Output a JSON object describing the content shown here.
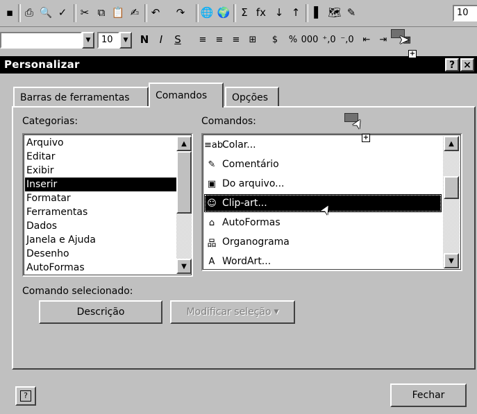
{
  "toolbar": {
    "row1_icons": [
      "save-icon",
      "print-icon",
      "print-preview-icon",
      "spell-check-icon",
      "cut-icon",
      "copy-icon",
      "paste-icon",
      "format-painter-icon",
      "undo-icon",
      "redo-icon",
      "hyperlink-icon",
      "web-icon",
      "autosum-icon",
      "function-icon",
      "sort-asc-icon",
      "sort-desc-icon",
      "chart-wizard-icon",
      "map-icon",
      "drawing-icon"
    ],
    "row1_glyphs": [
      "▪",
      "⎙",
      "🔍",
      "✓",
      "✂",
      "⧉",
      "📋",
      "✍",
      "↶",
      "↷",
      "🌐",
      "🌍",
      "Σ",
      "fx",
      "↓",
      "↑",
      "▌",
      "🗺",
      "✎"
    ],
    "font_size_value": "10",
    "font_size_right": "10",
    "format_icons": [
      "bold-icon",
      "italic-icon",
      "underline-icon",
      "align-left-icon",
      "align-center-icon",
      "align-right-icon",
      "merge-center-icon",
      "currency-icon",
      "percent-icon",
      "thousands-icon",
      "increase-decimal-icon",
      "decrease-decimal-icon",
      "decrease-indent-icon",
      "increase-indent-icon",
      "borders-icon"
    ],
    "format_glyphs": [
      "N",
      "I",
      "S",
      "≡",
      "≡",
      "≡",
      "⊞",
      "$",
      "%",
      "000",
      "⁺,0",
      "⁻,0",
      "⇤",
      "⇥",
      "▦"
    ]
  },
  "dialog": {
    "title": "Personalizar",
    "help_btn": "?",
    "close_btn": "×",
    "tabs": [
      "Barras de ferramentas",
      "Comandos",
      "Opções"
    ],
    "categories_label": "Categorias:",
    "commands_label": "Comandos:",
    "categories": [
      "Arquivo",
      "Editar",
      "Exibir",
      "Inserir",
      "Formatar",
      "Ferramentas",
      "Dados",
      "Janela e Ajuda",
      "Desenho",
      "AutoFormas"
    ],
    "selected_category": "Inserir",
    "commands": [
      {
        "icon": "text-field-icon",
        "glyph": "≡ab",
        "label": "Colar..."
      },
      {
        "icon": "comment-icon",
        "glyph": "✎",
        "label": "Comentário"
      },
      {
        "icon": "picture-from-file-icon",
        "glyph": "▣",
        "label": "Do arquivo..."
      },
      {
        "icon": "clip-art-icon",
        "glyph": "☺",
        "label": "Clip-art..."
      },
      {
        "icon": "autoshapes-icon",
        "glyph": "⌂",
        "label": "AutoFormas"
      },
      {
        "icon": "org-chart-icon",
        "glyph": "品",
        "label": "Organograma"
      },
      {
        "icon": "wordart-icon",
        "glyph": "A",
        "label": "WordArt..."
      }
    ],
    "selected_command": "Clip-art...",
    "selected_command_label": "Comando selecionado:",
    "description_btn": "Descrição",
    "modify_btn": "Modificar seleção",
    "close_button": "Fechar",
    "help_icon_btn": "?"
  }
}
